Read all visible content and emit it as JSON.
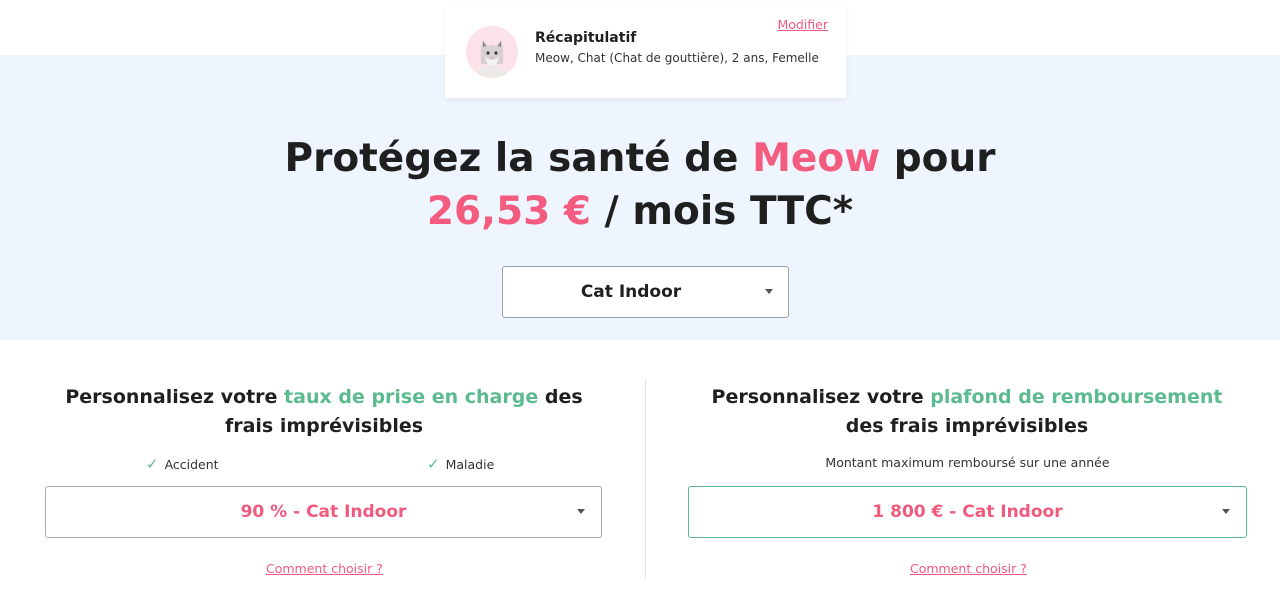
{
  "recap": {
    "title": "Récapitulatif",
    "description": "Meow, Chat (Chat de gouttière), 2 ans, Femelle",
    "edit_label": "Modifier",
    "avatar_icon": "cat-photo"
  },
  "hero": {
    "line1_prefix": "Protégez la santé de ",
    "pet_name": "Meow",
    "line1_suffix": " pour",
    "price": "26,53 €",
    "line2_suffix": " / mois TTC*",
    "plan_select": {
      "value": "Cat Indoor",
      "icon": "chevron-down-icon"
    }
  },
  "coverage_rate": {
    "title_prefix": "Personnalisez votre ",
    "title_highlight": "taux de prise en charge",
    "title_suffix_1": " des",
    "title_line2": "frais imprévisibles",
    "checks": [
      {
        "label": "Accident",
        "icon": "check-icon"
      },
      {
        "label": "Maladie",
        "icon": "check-icon"
      }
    ],
    "select_value": "90 % - Cat Indoor",
    "help_link": "Comment choisir ?"
  },
  "reimbursement_cap": {
    "title_prefix": "Personnalisez votre ",
    "title_highlight": "plafond de remboursement",
    "title_line2": "des frais imprévisibles",
    "helper": "Montant maximum remboursé sur une année",
    "select_value": "1 800 € - Cat Indoor",
    "help_link": "Comment choisir ?"
  },
  "colors": {
    "accent_pink": "#f45c7f",
    "accent_green": "#5bbb8e",
    "hero_background": "#eef5ff"
  }
}
